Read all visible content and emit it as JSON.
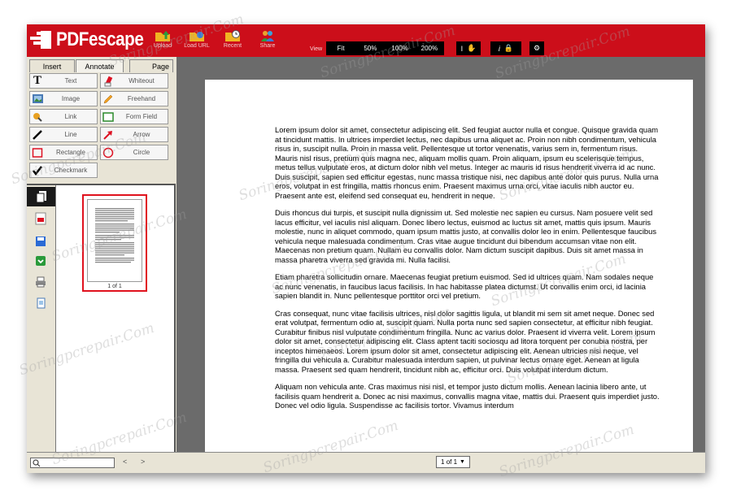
{
  "app": {
    "logo_text": "PDFescape",
    "brand_color": "#cc0e1a"
  },
  "toolbar": {
    "upload_label": "Upload",
    "load_url_label": "Load URL",
    "recent_label": "Recent",
    "share_label": "Share",
    "view_label": "View",
    "zoom_options": [
      "Fit",
      "50%",
      "100%",
      "200%"
    ]
  },
  "tabs": {
    "insert": "Insert",
    "annotate": "Annotate",
    "page": "Page"
  },
  "tools": {
    "text": "Text",
    "whiteout": "Whiteout",
    "image": "Image",
    "freehand": "Freehand",
    "link": "Link",
    "form_field": "Form Field",
    "line": "Line",
    "arrow": "Arrow",
    "rectangle": "Rectangle",
    "circle": "Circle",
    "checkmark": "Checkmark"
  },
  "thumbnail": {
    "label": "1 of 1"
  },
  "document": {
    "paragraphs": [
      "Lorem ipsum dolor sit amet, consectetur adipiscing elit. Sed feugiat auctor nulla et congue. Quisque gravida quam at tincidunt mattis. In ultrices imperdiet lectus, nec dapibus urna aliquet ac. Proin non nibh condimentum, vehicula risus in, suscipit nulla. Proin in massa velit. Pellentesque ut tortor venenatis, varius sem in, fermentum risus. Mauris nisl risus, pretium quis magna nec, aliquam mollis quam. Proin aliquam, ipsum eu scelerisque tempus, metus tellus vulputate eros, at dictum dolor nibh vel metus. Integer ac mauris id risus hendrerit viverra id ac nunc. Duis suscipit, sapien sed efficitur egestas, nunc massa tristique nisi, nec dapibus ante dolor quis purus. Nulla urna eros, volutpat in est fringilla, mattis rhoncus enim. Praesent maximus urna orci, vitae iaculis nibh auctor eu. Praesent ante est, eleifend sed consequat eu, hendrerit in neque.",
      "Duis rhoncus dui turpis, et suscipit nulla dignissim ut. Sed molestie nec sapien eu cursus. Nam posuere velit sed lacus efficitur, vel iaculis nisl aliquam. Donec libero lectus, euismod ac luctus sit amet, mattis quis ipsum. Mauris molestie, nunc in aliquet commodo, quam ipsum mattis justo, at convallis dolor leo in enim. Pellentesque faucibus vehicula neque malesuada condimentum. Cras vitae augue tincidunt dui bibendum accumsan vitae non elit. Maecenas non pretium quam. Nullam eu convallis dolor. Nam dictum suscipit dapibus. Duis sit amet massa in massa pharetra viverra sed gravida mi. Nulla facilisi.",
      "Etiam pharetra sollicitudin ornare. Maecenas feugiat pretium euismod. Sed id ultrices quam. Nam sodales neque ac nunc venenatis, in faucibus lacus facilisis. In hac habitasse platea dictumst. Ut convallis enim orci, id lacinia sapien blandit in. Nunc pellentesque porttitor orci vel pretium.",
      "Cras consequat, nunc vitae facilisis ultrices, nisl dolor sagittis ligula, ut blandit mi sem sit amet neque. Donec sed erat volutpat, fermentum odio at, suscipit quam. Nulla porta nunc sed sapien consectetur, at efficitur nibh feugiat. Curabitur finibus nisl vulputate condimentum fringilla. Nunc ac varius dolor. Praesent id viverra velit. Lorem ipsum dolor sit amet, consectetur adipiscing elit. Class aptent taciti sociosqu ad litora torquent per conubia nostra, per inceptos himenaeos. Lorem ipsum dolor sit amet, consectetur adipiscing elit. Aenean ultricies nisi neque, vel fringilla dui vehicula a. Curabitur malesuada interdum sapien, ut pulvinar lectus ornare eget. Aenean at ligula massa. Praesent sed quam hendrerit, tincidunt nibh ac, efficitur orci. Duis volutpat interdum dictum.",
      "Aliquam non vehicula ante. Cras maximus nisi nisl, et tempor justo dictum mollis. Aenean lacinia libero ante, ut facilisis quam hendrerit a. Donec ac nisi maximus, convallis magna vitae, mattis dui. Praesent quis imperdiet justo. Donec vel odio ligula. Suspendisse ac facilisis tortor. Vivamus interdum"
    ]
  },
  "bottombar": {
    "prev_label": "<",
    "next_label": ">",
    "page_select_value": "1 of 1"
  },
  "watermark": {
    "text": "Soringpcrepair.Com"
  }
}
